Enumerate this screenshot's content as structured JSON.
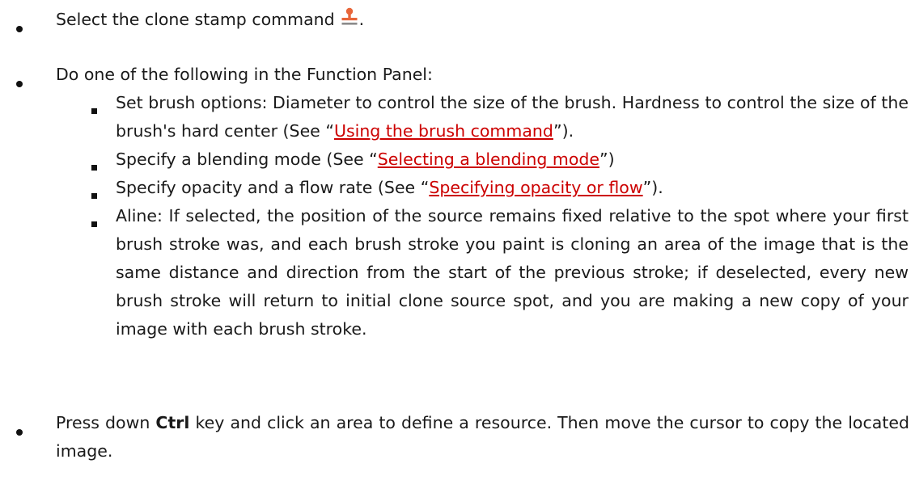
{
  "steps": [
    {
      "text": "Select the clone stamp command",
      "icon": "clone-stamp-icon",
      "trailing": "."
    },
    {
      "text": "Do one of the following in the Function Panel:",
      "sub": [
        {
          "prefix": "Set brush options: Diameter to control the size of the brush. Hardness to control the size of the brush's hard center (See “",
          "link": "Using the brush command",
          "suffix": "”)."
        },
        {
          "prefix": "Specify a blending mode (See “",
          "link": "Selecting a blending mode",
          "suffix": "”)"
        },
        {
          "prefix": "Specify opacity and a flow rate (See “",
          "link": "Specifying opacity or flow",
          "suffix": "”)."
        },
        {
          "text": "Aline: If selected, the position of the source remains fixed relative to the spot where your first brush stroke was, and each brush stroke you paint is cloning an area of the image that is the same distance and direction from the start of the previous stroke; if deselected, every new brush stroke will return to initial clone source spot, and you are making a new copy of your image with each brush stroke."
        }
      ]
    },
    {
      "pre": "Press down ",
      "bold": "Ctrl",
      "post": " key and click an area to define a resource. Then move the cursor to copy the located image."
    }
  ],
  "colors": {
    "link": "#cc0000",
    "stamp_top": "#e8663a",
    "stamp_base": "#e8663a",
    "stamp_line": "#8a8a8a"
  }
}
